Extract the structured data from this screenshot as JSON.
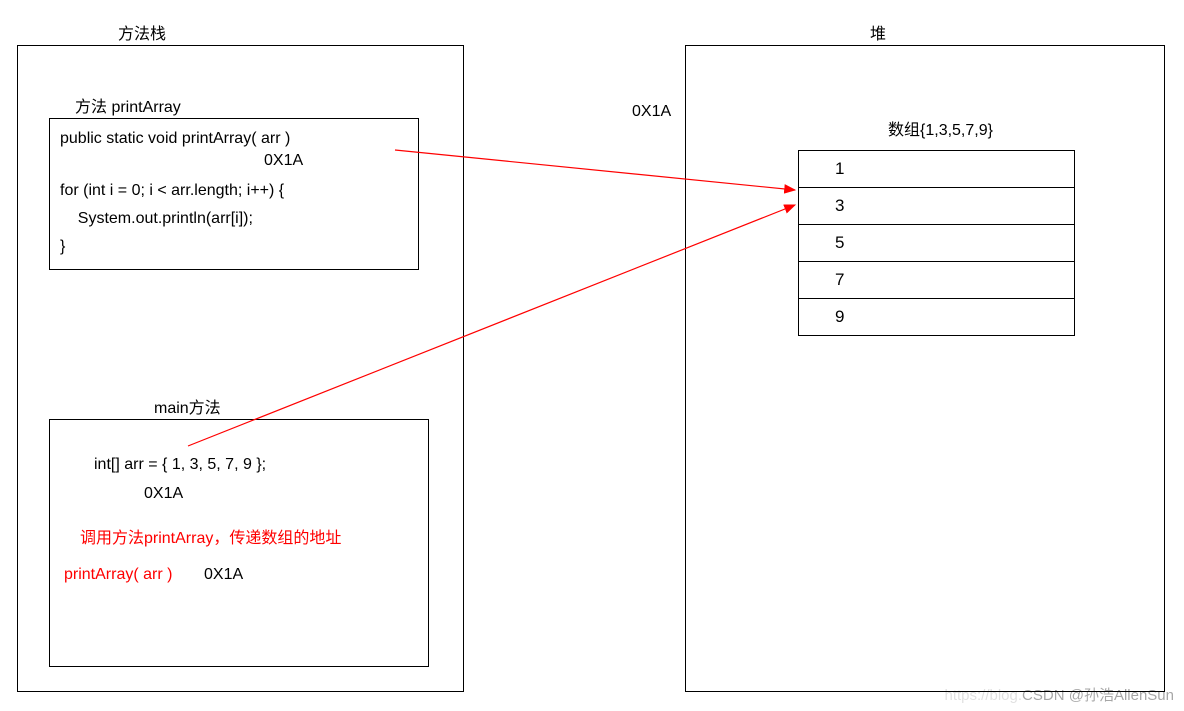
{
  "titles": {
    "stack": "方法栈",
    "heap": "堆"
  },
  "printArray": {
    "header": "方法 printArray",
    "line1": "public static void printArray( arr )",
    "addr": "0X1A",
    "line2": "for (int i = 0; i < arr.length; i++) {",
    "line3": "    System.out.println(arr[i]);",
    "line4": "}"
  },
  "main": {
    "header": "main方法",
    "line1": "int[] arr = { 1, 3, 5, 7, 9 };",
    "addr": "0X1A",
    "note": "调用方法printArray，传递数组的地址",
    "call": "printArray( arr )",
    "callAddr": "0X1A"
  },
  "heap": {
    "pointerLabel": "0X1A",
    "arrayTitle": "数组{1,3,5,7,9}",
    "values": [
      "1",
      "3",
      "5",
      "7",
      "9"
    ]
  },
  "watermark": {
    "faint": "https://blog.",
    "text": "CSDN @孙浩AllenSun"
  }
}
